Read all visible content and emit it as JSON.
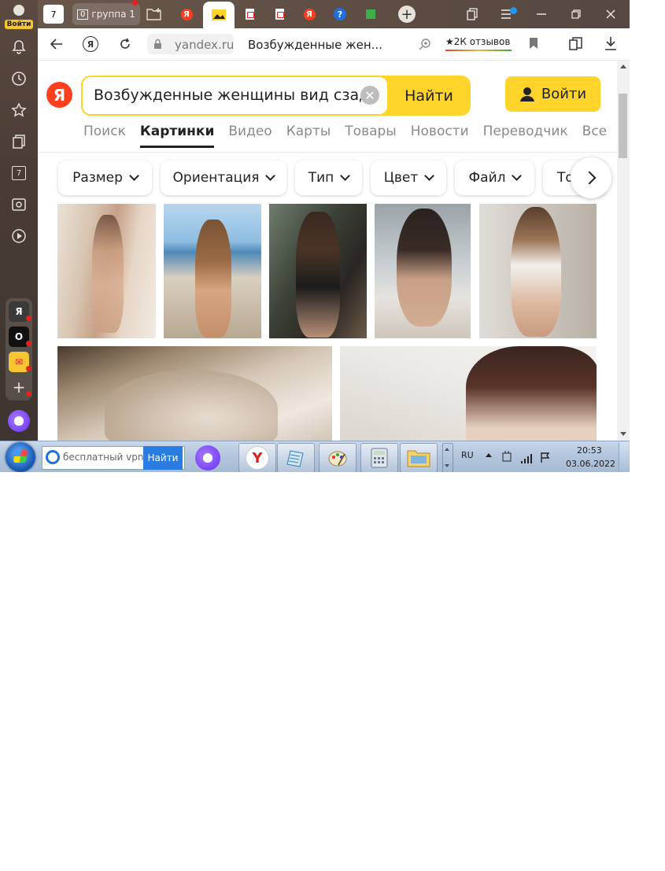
{
  "sidebar": {
    "profile_badge": "Войти",
    "app_count": "7",
    "apps": [
      "Я",
      "О",
      "✉",
      "+"
    ]
  },
  "tabs": {
    "home_count": "7",
    "group_count": "0",
    "group_label": "группа 1"
  },
  "addressbar": {
    "domain": "yandex.ru",
    "page_title": "Возбужденные жен...",
    "reviews": "★2К отзывов"
  },
  "search": {
    "logo": "Я",
    "query": "Возбужденные женщины вид сзади",
    "find_label": "Найти",
    "login_label": "Войти"
  },
  "services": [
    "Поиск",
    "Картинки",
    "Видео",
    "Карты",
    "Товары",
    "Новости",
    "Переводчик",
    "Все"
  ],
  "active_service": "Картинки",
  "filters": [
    "Размер",
    "Ориентация",
    "Тип",
    "Цвет",
    "Файл",
    "То"
  ],
  "taskbar": {
    "search_text": "бесплатный vpn",
    "search_button": "Найти",
    "lang": "RU",
    "time": "20:53",
    "date": "03.06.2022"
  },
  "colors": {
    "yandex_yellow": "#fed42b",
    "yandex_red": "#fc3f1d",
    "sidebar": "#4a3c35"
  }
}
